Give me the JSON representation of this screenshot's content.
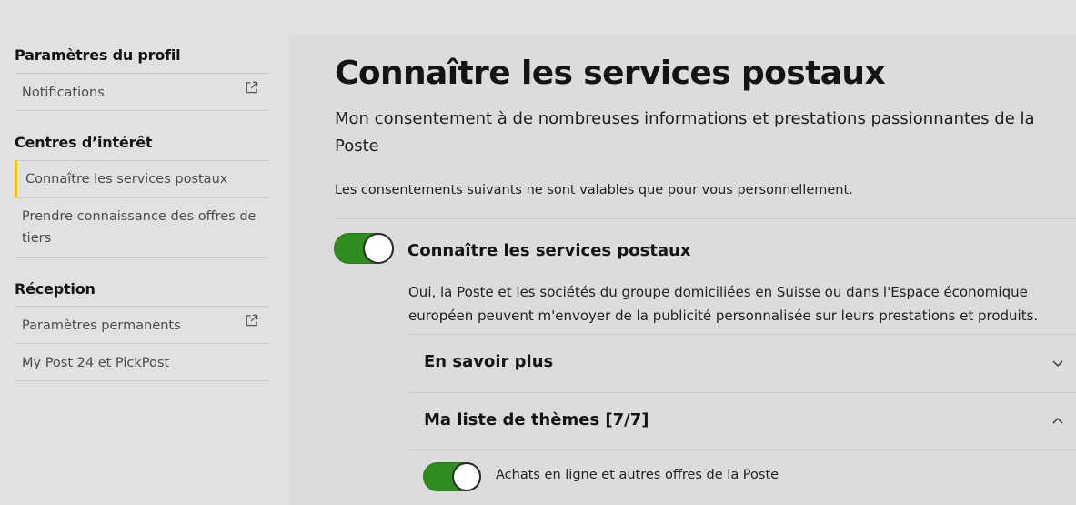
{
  "sidebar": {
    "groups": [
      {
        "title": "Paramètres du profil",
        "items": [
          {
            "label": "Notifications",
            "icon": "external-link-icon"
          }
        ]
      },
      {
        "title": "Centres d’intérêt",
        "items": [
          {
            "label": "Connaître les services postaux",
            "active": true
          },
          {
            "label": "Prendre connaissance des offres de tiers"
          }
        ]
      },
      {
        "title": "Réception",
        "items": [
          {
            "label": "Paramètres permanents",
            "icon": "external-link-icon"
          },
          {
            "label": "My Post 24 et PickPost"
          }
        ]
      }
    ]
  },
  "main": {
    "title": "Connaître les services postaux",
    "lead": "Mon consentement à de nombreuses informations et prestations passionnantes de la Poste",
    "note": "Les consentements suivants ne sont valables que pour vous personnellement.",
    "consent": {
      "label": "Connaître les services postaux",
      "checked": true,
      "description": "Oui, la Poste et les sociétés du groupe domiciliées en Suisse ou dans l'Espace économique européen peuvent m'envoyer de la publicité personnalisée sur leurs prestations et produits."
    },
    "accordions": [
      {
        "title": "En savoir plus",
        "expanded": false
      },
      {
        "title": "Ma liste de thèmes [7/7]",
        "expanded": true
      }
    ],
    "topics": [
      {
        "label": "Achats en ligne et autres offres de la Poste",
        "checked": true
      }
    ]
  },
  "colors": {
    "accent_yellow": "#f2c200",
    "toggle_green": "#2f8c1e"
  }
}
